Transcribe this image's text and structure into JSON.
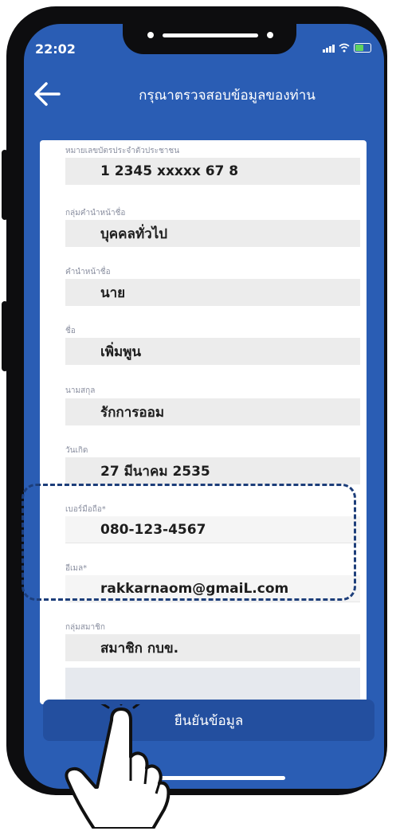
{
  "status_bar": {
    "time": "22:02"
  },
  "header": {
    "title": "กรุณาตรวจสอบข้อมูลของท่าน",
    "back_icon": "arrow-left-icon"
  },
  "fields": [
    {
      "label": "หมายเลขบัตรประจำตัวประชาชน",
      "value": "1 2345 xxxxx 67 8"
    },
    {
      "label": "กลุ่มคำนำหน้าชื่อ",
      "value": "บุคคลทั่วไป"
    },
    {
      "label": "คำนำหน้าชื่อ",
      "value": "นาย"
    },
    {
      "label": "ชื่อ",
      "value": "เพิ่มพูน"
    },
    {
      "label": "นามสกุล",
      "value": "รักการออม"
    },
    {
      "label": "วันเกิด",
      "value": "27 มีนาคม 2535"
    },
    {
      "label": "เบอร์มือถือ*",
      "value": "080-123-4567"
    },
    {
      "label": "อีเมล*",
      "value": "rakkarnaom@gmaiL.com"
    },
    {
      "label": "กลุ่มสมาชิก",
      "value": "สมาชิก กบข."
    }
  ],
  "confirm_button": {
    "label": "ยืนยันข้อมูล"
  },
  "colors": {
    "primary": "#2a5db4",
    "button": "#234f9f",
    "highlight_border": "#1d3e7a"
  }
}
